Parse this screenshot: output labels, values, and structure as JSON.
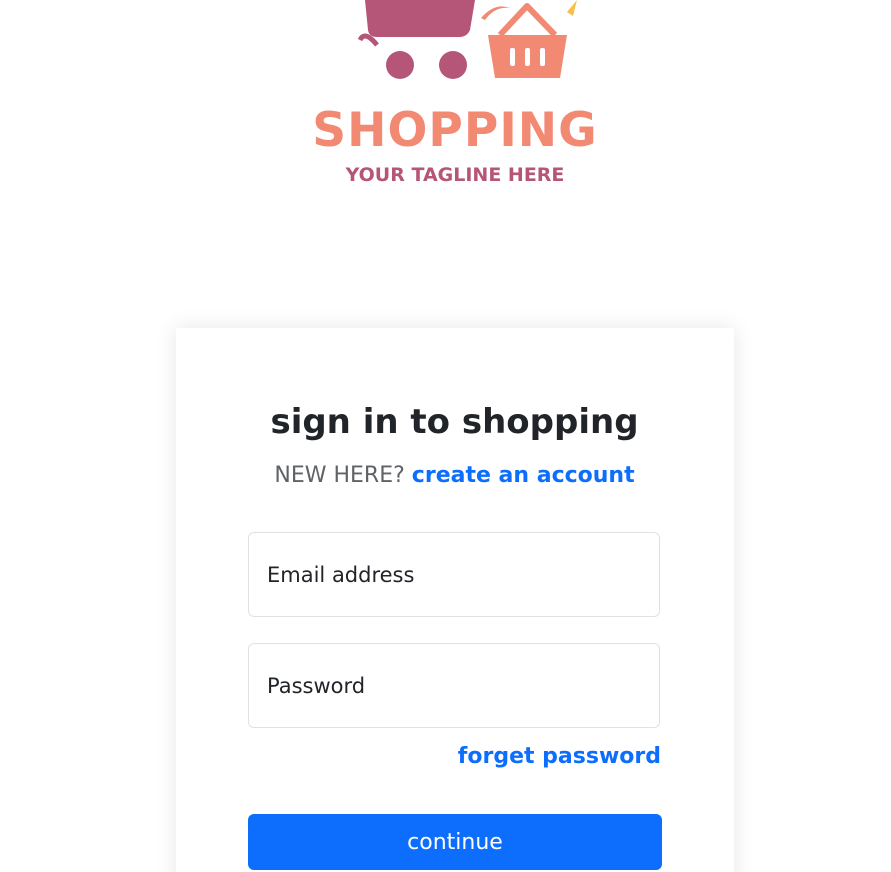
{
  "brand": {
    "name": "SHOPPING",
    "tagline": "YOUR TAGLINE HERE",
    "logo_icon": "shopping-cart-and-basket-icon",
    "colors": {
      "primary": "#f28a73",
      "secondary": "#b55577"
    }
  },
  "signin": {
    "title": "sign in to shopping",
    "new_here_text": "NEW HERE?",
    "create_account_link": "create an account",
    "email_placeholder": "Email address",
    "password_placeholder": "Password",
    "forgot_password_link": "forget password",
    "continue_button": "continue"
  },
  "colors": {
    "accent": "#0d6efd",
    "text": "#212529",
    "border": "#dee2e6"
  }
}
